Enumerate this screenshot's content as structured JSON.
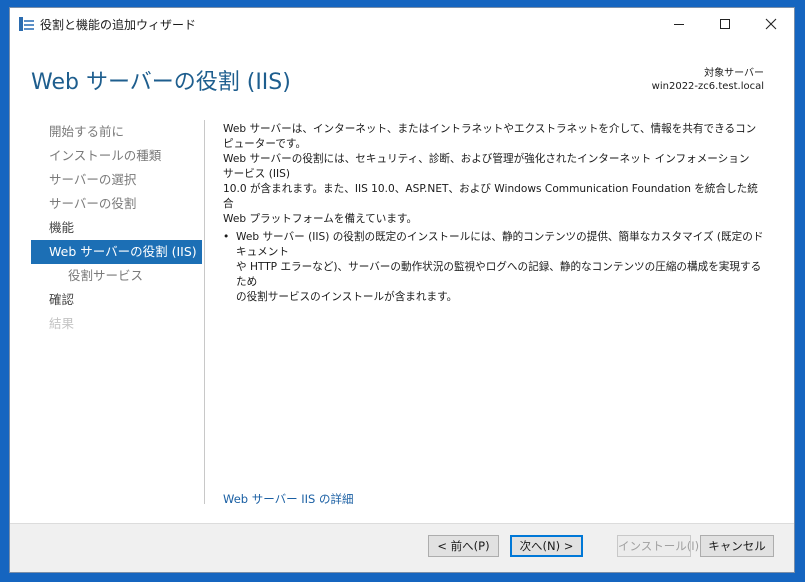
{
  "window": {
    "title": "役割と機能の追加ウィザード"
  },
  "header": {
    "page_title": "Web サーバーの役割 (IIS)",
    "target_label": "対象サーバー",
    "target_server": "win2022-zc6.test.local"
  },
  "nav": {
    "items": [
      {
        "label": "開始する前に"
      },
      {
        "label": "インストールの種類"
      },
      {
        "label": "サーバーの選択"
      },
      {
        "label": "サーバーの役割"
      },
      {
        "label": "機能"
      },
      {
        "label": "Web サーバーの役割 (IIS)"
      },
      {
        "label": "役割サービス"
      },
      {
        "label": "確認"
      },
      {
        "label": "結果"
      }
    ]
  },
  "content": {
    "description_lines": [
      "Web サーバーは、インターネット、またはイントラネットやエクストラネットを介して、情報を共有できるコンピューターです。",
      "Web サーバーの役割には、セキュリティ、診断、および管理が強化されたインターネット インフォメーション サービス (IIS)",
      "10.0 が含まれます。また、IIS 10.0、ASP.NET、および Windows Communication Foundation を統合した統合",
      "Web プラットフォームを備えています。"
    ],
    "bullet_lines": [
      "Web サーバー (IIS) の役割の既定のインストールには、静的コンテンツの提供、簡単なカスタマイズ (既定のドキュメント",
      "や HTTP エラーなど)、サーバーの動作状況の監視やログへの記録、静的なコンテンツの圧縮の構成を実現するため",
      "の役割サービスのインストールが含まれます。"
    ],
    "bullet_symbol": "•",
    "details_link": "Web サーバー IIS の詳細"
  },
  "footer": {
    "prev_label": "< 前へ(P)",
    "next_label": "次へ(N) >",
    "install_label": "インストール(I)",
    "cancel_label": "キャンセル"
  },
  "colors": {
    "accent": "#1c6fb5",
    "title": "#1e5e8e",
    "link": "#1a5fa3",
    "desktop": "#1565c0"
  }
}
